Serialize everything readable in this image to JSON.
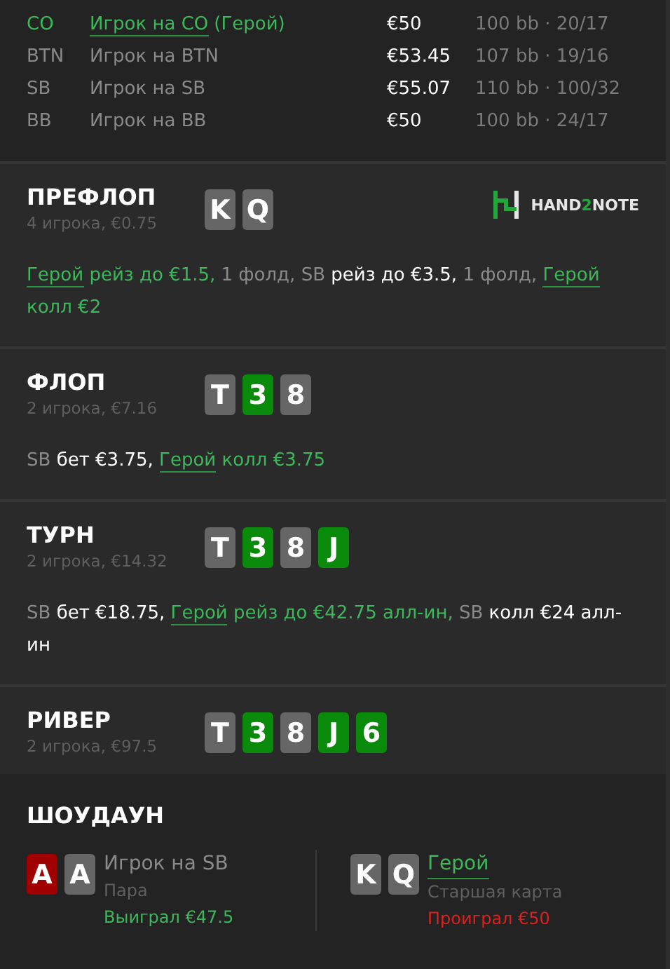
{
  "players": [
    {
      "position": "CO",
      "name": "Игрок на CO",
      "hero_tag": "(Герой)",
      "hero": true,
      "stack": "€50",
      "bb": "100 bb",
      "separator": "·",
      "stats": "20/17"
    },
    {
      "position": "BTN",
      "name": "Игрок на BTN",
      "hero": false,
      "stack": "€53.45",
      "bb": "107 bb",
      "separator": "·",
      "stats": "19/16"
    },
    {
      "position": "SB",
      "name": "Игрок на SB",
      "hero": false,
      "stack": "€55.07",
      "bb": "110 bb",
      "separator": "·",
      "stats": "100/32"
    },
    {
      "position": "BB",
      "name": "Игрок на BB",
      "hero": false,
      "stack": "€50",
      "bb": "100 bb",
      "separator": "·",
      "stats": "24/17"
    }
  ],
  "streets": [
    {
      "title": "ПРЕФЛОП",
      "subtitle": "4 игрока, €0.75",
      "logo": [
        {
          "text": "HAND",
          "accent": false
        },
        {
          "text": "2",
          "accent": true
        },
        {
          "text": "NOTE",
          "accent": false
        }
      ],
      "cards": [
        {
          "rank": "K",
          "color": "#666666"
        },
        {
          "rank": "Q",
          "color": "#666666"
        }
      ],
      "actions": [
        {
          "text": "Герой",
          "kind": "hero"
        },
        {
          "text": "рейз до €1.5,",
          "kind": "hero-action"
        },
        {
          "text": "1 фолд,",
          "kind": "player"
        },
        {
          "text": "SB",
          "kind": "player"
        },
        {
          "text": "рейз до €3.5,",
          "kind": "action"
        },
        {
          "text": "1 фолд,",
          "kind": "player"
        },
        {
          "text": "Герой",
          "kind": "hero"
        },
        {
          "text": "колл €2",
          "kind": "hero-action"
        }
      ]
    },
    {
      "title": "ФЛОП",
      "subtitle": "2 игрока, €7.16",
      "cards": [
        {
          "rank": "T",
          "color": "#666666"
        },
        {
          "rank": "3",
          "color": "#0a8a0a"
        },
        {
          "rank": "8",
          "color": "#666666"
        }
      ],
      "actions": [
        {
          "text": "SB",
          "kind": "player"
        },
        {
          "text": "бет €3.75,",
          "kind": "action"
        },
        {
          "text": "Герой",
          "kind": "hero"
        },
        {
          "text": "колл €3.75",
          "kind": "hero-action"
        }
      ]
    },
    {
      "title": "ТУРН",
      "subtitle": "2 игрока, €14.32",
      "cards": [
        {
          "rank": "T",
          "color": "#666666"
        },
        {
          "rank": "3",
          "color": "#0a8a0a"
        },
        {
          "rank": "8",
          "color": "#666666"
        },
        {
          "rank": "J",
          "color": "#0a8a0a"
        }
      ],
      "actions": [
        {
          "text": "SB",
          "kind": "player"
        },
        {
          "text": "бет €18.75,",
          "kind": "action"
        },
        {
          "text": "Герой",
          "kind": "hero"
        },
        {
          "text": "рейз до €42.75 алл-ин,",
          "kind": "hero-action"
        },
        {
          "text": "SB",
          "kind": "player"
        },
        {
          "text": "колл €24 алл-ин",
          "kind": "action"
        }
      ]
    },
    {
      "title": "РИВЕР",
      "subtitle": "2 игрока, €97.5",
      "cards": [
        {
          "rank": "T",
          "color": "#666666"
        },
        {
          "rank": "3",
          "color": "#0a8a0a"
        },
        {
          "rank": "8",
          "color": "#666666"
        },
        {
          "rank": "J",
          "color": "#0a8a0a"
        },
        {
          "rank": "6",
          "color": "#0a8a0a"
        }
      ]
    }
  ],
  "showdown": {
    "title": "ШОУДАУН",
    "hands": [
      {
        "cards": [
          {
            "rank": "A",
            "color": "#a00000"
          },
          {
            "rank": "A",
            "color": "#666666"
          }
        ],
        "name": "Игрок на SB",
        "hero": false,
        "hand": "Пара",
        "result": "Выиграл €47.5",
        "kind": "won"
      },
      {
        "cards": [
          {
            "rank": "K",
            "color": "#666666"
          },
          {
            "rank": "Q",
            "color": "#666666"
          }
        ],
        "name": "Герой",
        "hero": true,
        "hand": "Старшая карта",
        "result": "Проиграл €50",
        "kind": "lost"
      }
    ]
  }
}
